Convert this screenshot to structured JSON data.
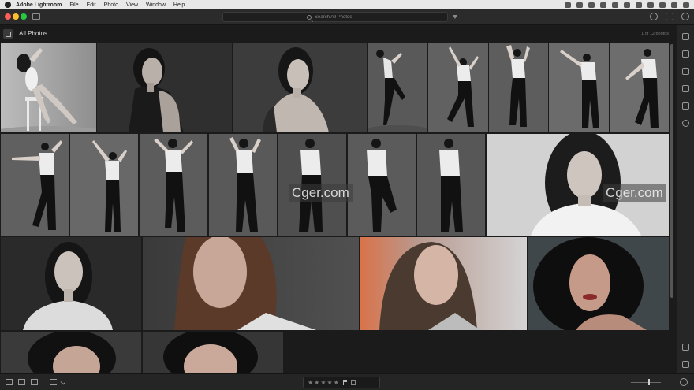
{
  "menubar": {
    "app": "Adobe Lightroom",
    "items": [
      "File",
      "Edit",
      "Photo",
      "View",
      "Window",
      "Help"
    ]
  },
  "toolbar": {
    "search_placeholder": "Search All Photos"
  },
  "header": {
    "title": "All Photos",
    "count": "1 of 12 photos"
  },
  "watermarks": [
    "Cger.com",
    "Cger.com"
  ],
  "rating": {
    "stars": [
      "★",
      "★",
      "★",
      "★",
      "★"
    ]
  },
  "colors": {
    "background": "#1b1b1b",
    "toolbar": "#2b2b2b",
    "selection": "#d9d9d9"
  }
}
